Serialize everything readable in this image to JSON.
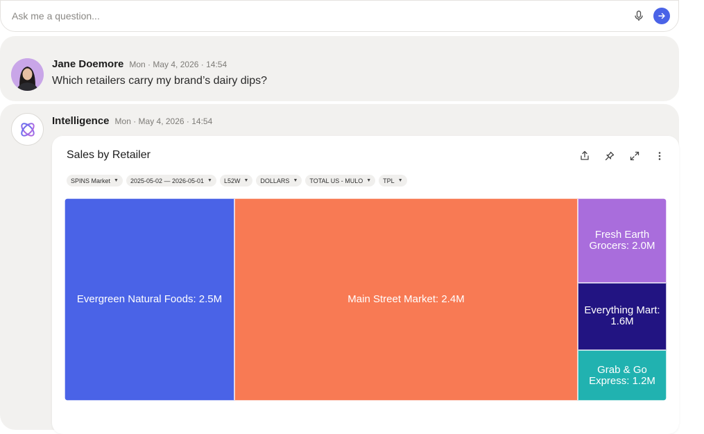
{
  "ask": {
    "placeholder": "Ask me a question...",
    "mic_icon": "microphone-icon",
    "send_icon": "arrow-right-icon",
    "send_color": "#4a63e7"
  },
  "messages": {
    "user": {
      "author": "Jane Doemore",
      "timestamp": "Mon · May 4, 2026 · 14:54",
      "text": "Which retailers carry my brand’s dairy dips?"
    },
    "ai": {
      "author": "Intelligence",
      "timestamp": "Mon · May 4, 2026 · 14:54",
      "logo_icon": "atom-icon"
    }
  },
  "card": {
    "title": "Sales by Retailer",
    "actions": [
      "share-icon",
      "pin-icon",
      "expand-icon",
      "more-vertical-icon"
    ],
    "filters": [
      {
        "label": "SPINS Market"
      },
      {
        "label": "2025-05-02 — 2026-05-01"
      },
      {
        "label": "L52W"
      },
      {
        "label": "DOLLARS"
      },
      {
        "label": "TOTAL US - MULO"
      },
      {
        "label": "TPL"
      }
    ]
  },
  "chart_data": {
    "type": "treemap",
    "title": "Sales by Retailer",
    "items": [
      {
        "name": "Evergreen Natural Foods",
        "label": "Evergreen Natural Foods: 2.5M",
        "value": 2.5,
        "color": "#4a63e7"
      },
      {
        "name": "Main Street Market",
        "label": "Main Street Market: 2.4M",
        "value": 2.4,
        "color": "#f87a54"
      },
      {
        "name": "Fresh Earth Grocers",
        "label": "Fresh Earth Grocers: 2.0M",
        "value": 2.0,
        "color": "#a96ddc"
      },
      {
        "name": "Everything Mart",
        "label": "Everything Mart: 1.6M",
        "value": 1.6,
        "color": "#221482"
      },
      {
        "name": "Grab & Go Express",
        "label": "Grab & Go Express: 1.2M",
        "value": 1.2,
        "color": "#21b2b0"
      }
    ]
  }
}
